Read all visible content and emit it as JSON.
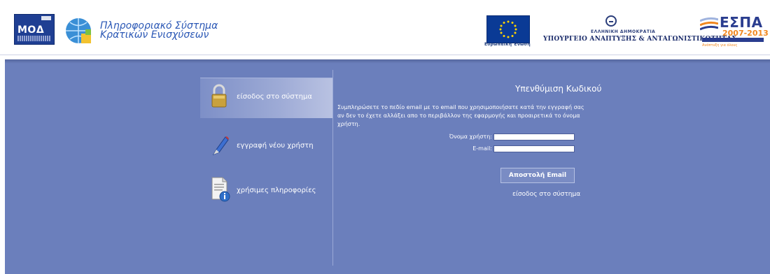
{
  "header": {
    "moda_logo_text": "ΜΟΔ",
    "system_title_line1": "Πληροφοριακό Σύστημα",
    "system_title_line2": "Κρατικών Ενισχύσεων",
    "eu_caption": "Ευρωπαϊκή Ένωση",
    "greek_republic": "ΕΛΛΗΝΙΚΗ ΔΗΜΟΚΡΑΤΙΑ",
    "ministry": "ΥΠΟΥΡΓΕΙΟ ΑΝΑΠΤΥΞΗΣ & ΑΝΤΑΓΩΝΙΣΤΙΚΟΤΗΤΑΣ",
    "espa_title": "ΕΣΠΑ",
    "espa_years": "2007-2013",
    "espa_tagline": "Ανάπτυξη για όλους"
  },
  "menu": {
    "items": [
      {
        "label": "είσοδος στο σύστημα",
        "icon": "lock-icon",
        "active": true
      },
      {
        "label": "εγγραφή νέου χρήστη",
        "icon": "pen-icon",
        "active": false
      },
      {
        "label": "χρήσιμες πληροφορίες",
        "icon": "info-document-icon",
        "active": false
      }
    ]
  },
  "form": {
    "title": "Υπενθύμιση Κωδικού",
    "description": "Συμπληρώσετε το πεδίο email με το email που χρησιμοποιήσατε κατά την εγγραφή σας αν δεν το έχετε αλλάξει απο το περιβάλλον της εφαρμογής και προαιρετικά το όνομα χρήστη.",
    "username_label": "Όνομα χρήστη:",
    "username_value": "",
    "email_label": "E-mail:",
    "email_value": "",
    "send_button": "Αποστολή Email",
    "login_link": "είσοδος στο σύστημα"
  },
  "colors": {
    "main_bg": "#6b7fbc",
    "active_menu": "#9eabd6",
    "header_blue": "#2a57b5",
    "espa_orange": "#f1871f"
  }
}
